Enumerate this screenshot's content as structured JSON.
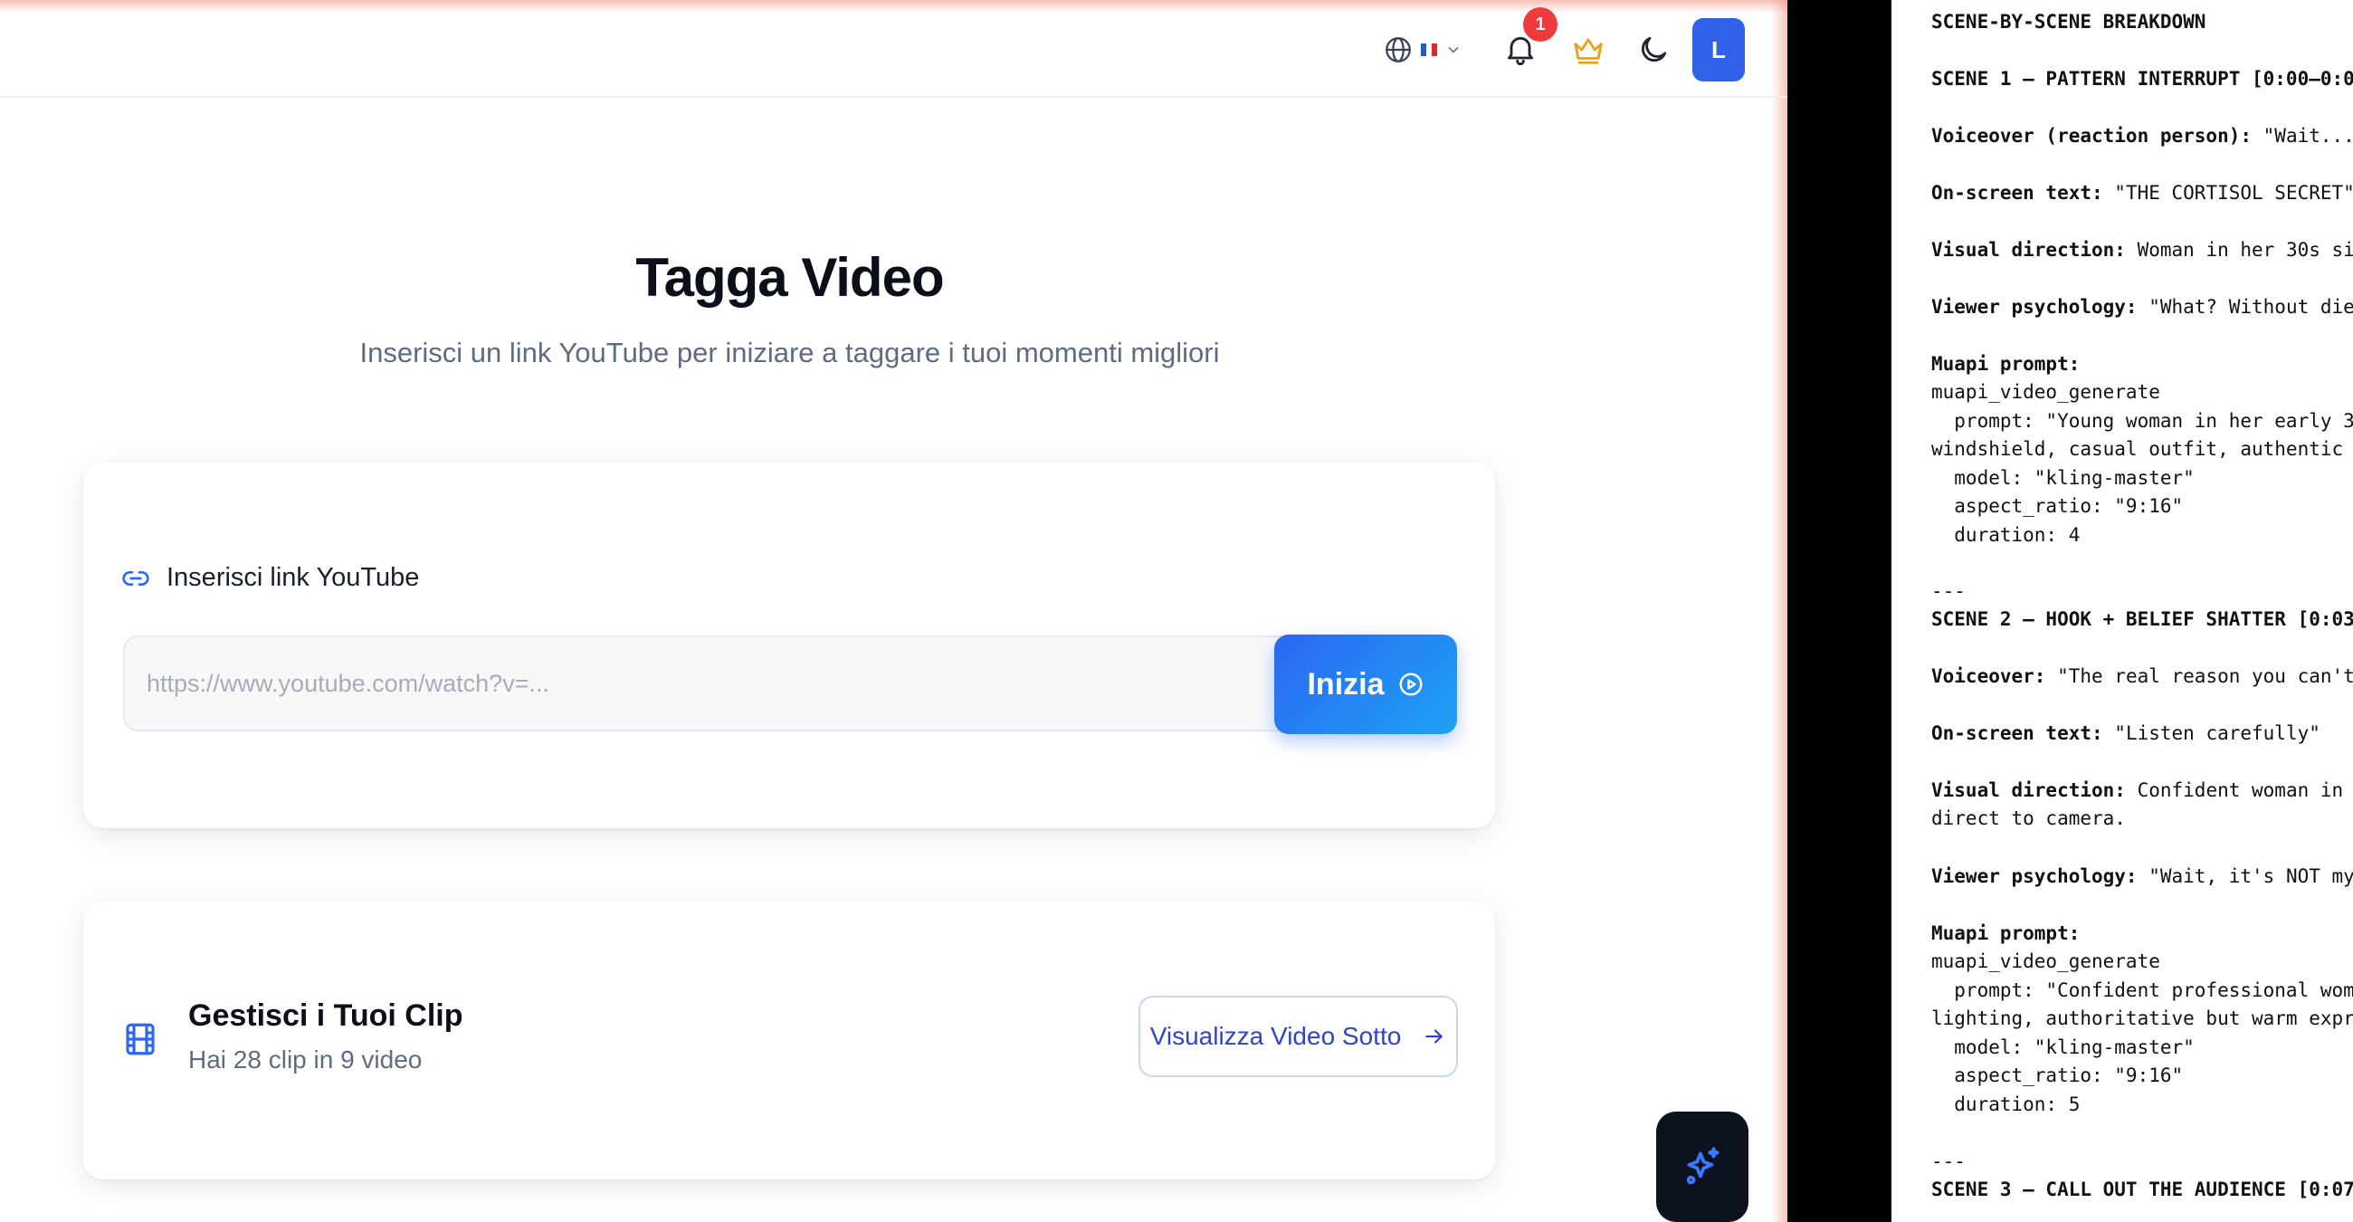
{
  "header": {
    "language_flag_colors": [
      "#1f5fbf",
      "#ffffff",
      "#d82b2b"
    ],
    "notification_count": "1",
    "avatar_initial": "L",
    "icons": [
      "globe-icon",
      "chevron-down-icon",
      "bell-icon",
      "crown-icon",
      "moon-icon"
    ],
    "crown_color": "#e8a21a"
  },
  "main": {
    "title": "Tagga Video",
    "subtitle": "Inserisci un link YouTube per iniziare a taggare i tuoi momenti migliori",
    "link_card": {
      "label": "Inserisci link YouTube",
      "input_value": "",
      "input_placeholder": "https://www.youtube.com/watch?v=...",
      "button_label": "Inizia"
    },
    "clips_card": {
      "title": "Gestisci i Tuoi Clip",
      "subtitle": "Hai 28 clip in 9 video",
      "button_label": "Visualizza Video Sotto"
    }
  },
  "colors": {
    "primary": "#2b67f2",
    "accent_gradient_end": "#1ea2f6",
    "badge": "#ef3b3b",
    "avatar": "#2f62e8",
    "fab_bg": "#0d1220"
  },
  "doc": {
    "lines": [
      {
        "label": "SCENE-BY-SCENE BREAKDOWN",
        "text": ""
      },
      {
        "label": "SCENE 1 – PATTERN INTERRUPT [0:00–0:0",
        "text": ""
      },
      {
        "label": "Voiceover (reaction person):",
        "text": " \"Wait..."
      },
      {
        "label": "On-screen text:",
        "text": " \"THE CORTISOL SECRET\""
      },
      {
        "label": "Visual direction:",
        "text": " Woman in her 30s si"
      },
      {
        "label": "Viewer psychology:",
        "text": " \"What? Without die"
      },
      {
        "label": "Muapi prompt:",
        "text": ""
      },
      {
        "label": "",
        "text": "muapi_video_generate"
      },
      {
        "label": "",
        "text": "  prompt: \"Young woman in her early 3"
      },
      {
        "label": "",
        "text": "windshield, casual outfit, authentic"
      },
      {
        "label": "",
        "text": "  model: \"kling-master\""
      },
      {
        "label": "",
        "text": "  aspect_ratio: \"9:16\""
      },
      {
        "label": "",
        "text": "  duration: 4"
      },
      {
        "label": "",
        "text": "---"
      },
      {
        "label": "SCENE 2 – HOOK + BELIEF SHATTER [0:03",
        "text": ""
      },
      {
        "label": "Voiceover:",
        "text": " \"The real reason you can't"
      },
      {
        "label": "On-screen text:",
        "text": " \"Listen carefully\""
      },
      {
        "label": "Visual direction:",
        "text": " Confident woman in"
      },
      {
        "label": "",
        "text": "direct to camera."
      },
      {
        "label": "Viewer psychology:",
        "text": " \"Wait, it's NOT my"
      },
      {
        "label": "Muapi prompt:",
        "text": ""
      },
      {
        "label": "",
        "text": "muapi_video_generate"
      },
      {
        "label": "",
        "text": "  prompt: \"Confident professional wom"
      },
      {
        "label": "",
        "text": "lighting, authoritative but warm expr"
      },
      {
        "label": "",
        "text": "  model: \"kling-master\""
      },
      {
        "label": "",
        "text": "  aspect_ratio: \"9:16\""
      },
      {
        "label": "",
        "text": "  duration: 5"
      },
      {
        "label": "",
        "text": "---"
      },
      {
        "label": "SCENE 3 – CALL OUT THE AUDIENCE [0:07",
        "text": ""
      }
    ]
  }
}
